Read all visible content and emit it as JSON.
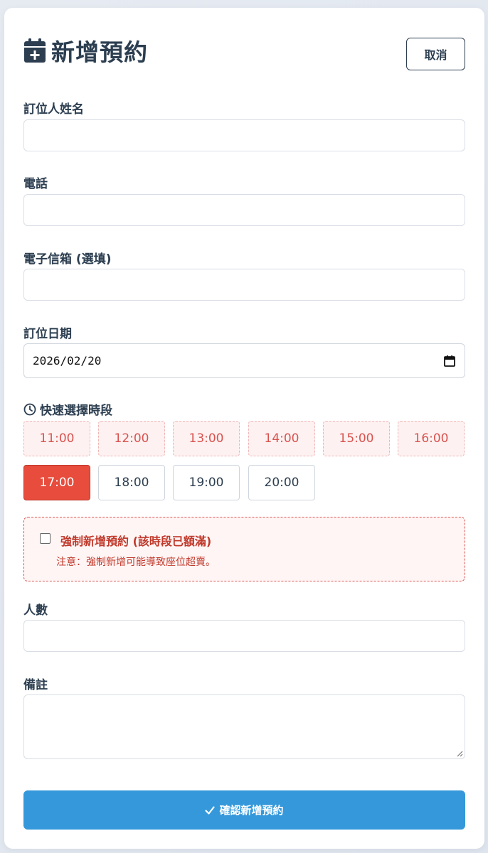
{
  "header": {
    "title": "新增預約",
    "cancel_label": "取消"
  },
  "form": {
    "name_label": "訂位人姓名",
    "name_value": "",
    "phone_label": "電話",
    "phone_value": "",
    "email_label": "電子信箱 (選填)",
    "email_value": "",
    "date_label": "訂位日期",
    "date_value": "2026/02/20",
    "timeslot_label": "快速選擇時段",
    "party_label": "人數",
    "party_value": "",
    "notes_label": "備註",
    "notes_value": ""
  },
  "timeslots": [
    {
      "time": "11:00",
      "state": "full"
    },
    {
      "time": "12:00",
      "state": "full"
    },
    {
      "time": "13:00",
      "state": "full"
    },
    {
      "time": "14:00",
      "state": "full"
    },
    {
      "time": "15:00",
      "state": "full"
    },
    {
      "time": "16:00",
      "state": "full"
    },
    {
      "time": "17:00",
      "state": "selected"
    },
    {
      "time": "18:00",
      "state": "open"
    },
    {
      "time": "19:00",
      "state": "open"
    },
    {
      "time": "20:00",
      "state": "open"
    }
  ],
  "force_add": {
    "label": "強制新增預約 (該時段已額滿)",
    "note": "注意：強制新增可能導致座位超賣。",
    "checked": false
  },
  "submit_label": "確認新增預約",
  "colors": {
    "primary": "#3498db",
    "danger": "#e74c3c",
    "text": "#2c3e50"
  }
}
